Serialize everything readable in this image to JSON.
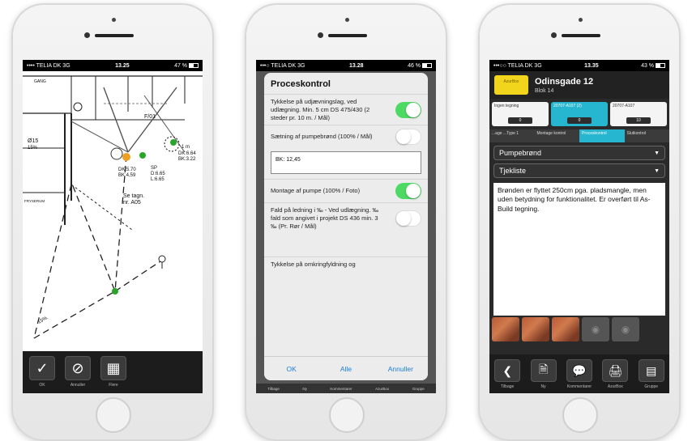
{
  "phone1": {
    "status": {
      "carrier": "•••• TELIA DK  3G",
      "time": "13.25",
      "battery": "47 %"
    },
    "plan_labels": {
      "l1": "Se tagn.",
      "l2": "nr. A05",
      "l3": "DK:5.70",
      "l4": "BK:4,59",
      "l5": "SP",
      "l6": "D:6.65",
      "l7": "L:6.65",
      "l8": "DK:6.64",
      "l9": "BK:3.22",
      "l10": "Ø15",
      "l11": "15%",
      "l12": "GANG",
      "l13": "FRYSERUM",
      "l14": "F/01",
      "l15": "1 m",
      "l16": "15%."
    },
    "toolbar": [
      {
        "icon": "✓",
        "label": "OK"
      },
      {
        "icon": "⊘",
        "label": "Annuller"
      },
      {
        "icon": "▦",
        "label": "Flere"
      }
    ]
  },
  "phone2": {
    "status": {
      "carrier": "•••○ TELIA DK  3G",
      "time": "13.28",
      "battery": "46 %"
    },
    "dialog": {
      "title": "Proceskontrol",
      "rows": [
        {
          "text": "Tykkelse på udjævningslag, ved udlægning. Min. 5 cm DS 475/430 (2 steder pr. 10 m. / Mål)",
          "on": true
        },
        {
          "text": "Sætning af pumpebrønd (100% / Mål)",
          "on": false
        },
        {
          "text": "Montage af pumpe (100% / Foto)",
          "on": true
        },
        {
          "text": "Fald på ledning i ‰ - Ved udlægning. ‰ fald som angivet i projekt DS 436 min. 3 ‰ (Pr. Rør / Mål)",
          "on": false
        }
      ],
      "input_value": "BK: 12,45",
      "last_row": "Tykkelse på omkringfyldning og",
      "buttons": {
        "ok": "OK",
        "all": "Alle",
        "cancel": "Annuller"
      }
    },
    "bg_labels": [
      "Tilbage",
      "Ny",
      "Kommentarer",
      "AzurBox",
      "Gruppe"
    ]
  },
  "phone3": {
    "status": {
      "carrier": "•••○○ TELIA DK  3G",
      "time": "13.35",
      "battery": "43 %"
    },
    "header": {
      "logo": "AzurBox",
      "title": "Odinsgade 12",
      "subtitle": "Blok 14"
    },
    "cards": [
      {
        "title": "Ingen tegning",
        "count": "0"
      },
      {
        "title": "20707-A107 (2)",
        "count": "0"
      },
      {
        "title": "20707-A107",
        "count": "10"
      }
    ],
    "tabs": [
      "...age ...Type 1",
      "Montage kontrol",
      "Proceskontrol",
      "Slutkontrol"
    ],
    "dropdown1": "Pumpebrønd",
    "dropdown2": "Tjekliste",
    "note": "Brønden er flyttet 250cm pga. pladsmangle, men uden betydning for funktionalitet. Er overført til As-Build tegning.",
    "toolbar": [
      {
        "icon": "❮",
        "label": "Tilbage"
      },
      {
        "icon": "🗎",
        "label": "Ny"
      },
      {
        "icon": "💬",
        "label": "Kommentarer"
      },
      {
        "icon": "🖨",
        "label": "AzurBox"
      },
      {
        "icon": "▤",
        "label": "Gruppe"
      }
    ]
  }
}
